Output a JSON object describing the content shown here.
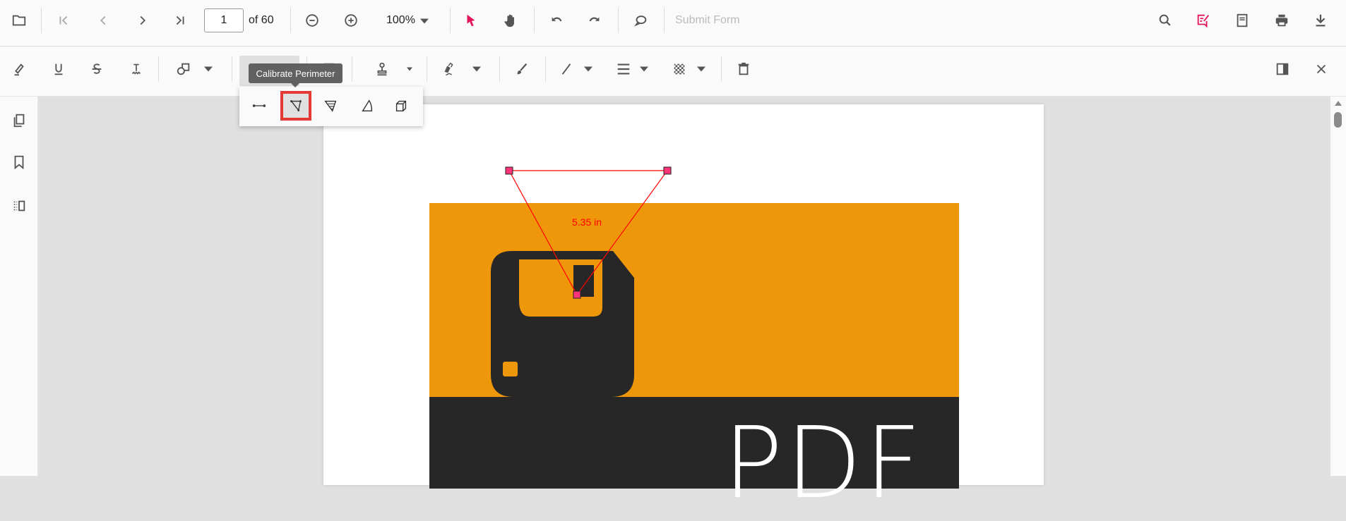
{
  "toolbar": {
    "page_number": "1",
    "page_total": "of 60",
    "zoom": "100%",
    "submit_form": "Submit Form"
  },
  "annotation_toolbar": {
    "tooltip": "Calibrate Perimeter"
  },
  "measure_menu": {
    "items": [
      "Calibrate Distance",
      "Calibrate Perimeter",
      "Calibrate Area",
      "Calibrate Radius",
      "Calibrate Volume"
    ],
    "selected": "Calibrate Perimeter"
  },
  "document": {
    "measurement_label": "5.35 in",
    "cover_text": "PDF"
  },
  "colors": {
    "accent": "#e3165b",
    "orange": "#ef970b",
    "dark": "#272727",
    "measure_red": "#ff0000"
  }
}
